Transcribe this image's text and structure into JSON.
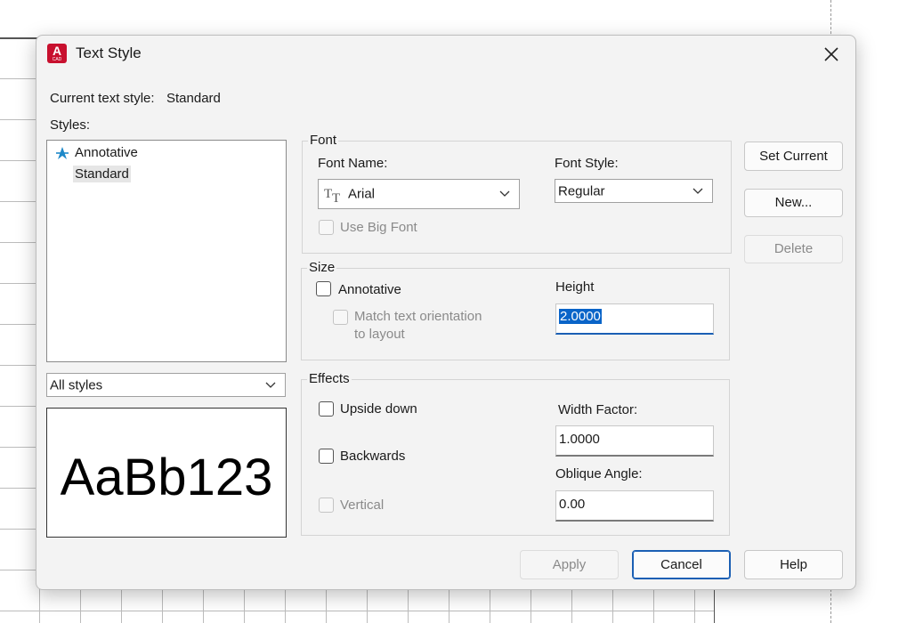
{
  "dialog": {
    "title": "Text Style",
    "app_icon": {
      "big": "A",
      "small": "CAD"
    }
  },
  "current_style": {
    "label": "Current text style:",
    "value": "Standard"
  },
  "styles": {
    "label": "Styles:",
    "items": [
      {
        "name": "Annotative",
        "icon": "annotative-icon"
      },
      {
        "name": "Standard",
        "selected": true
      }
    ],
    "filter": "All styles"
  },
  "preview": {
    "text": "AaBb123"
  },
  "font": {
    "group_label": "Font",
    "font_name_label": "Font Name:",
    "font_name_value": "Arial",
    "font_name_icon": "truetype-icon",
    "font_style_label": "Font Style:",
    "font_style_value": "Regular",
    "use_big_font": "Use Big Font"
  },
  "size": {
    "group_label": "Size",
    "annotative": "Annotative",
    "match_orientation_line1": "Match text orientation",
    "match_orientation_line2": "to layout",
    "height_label": "Height",
    "height_value": "2.0000"
  },
  "effects": {
    "group_label": "Effects",
    "upside_down": "Upside down",
    "backwards": "Backwards",
    "vertical": "Vertical",
    "width_factor_label": "Width Factor:",
    "width_factor_value": "1.0000",
    "oblique_label": "Oblique Angle:",
    "oblique_value": "0.00"
  },
  "buttons": {
    "set_current": "Set Current",
    "new": "New...",
    "delete": "Delete",
    "apply": "Apply",
    "cancel": "Cancel",
    "help": "Help"
  },
  "colors": {
    "accent": "#1a5fb4",
    "app_red": "#c8102e",
    "annotative_blue": "#1e88c8"
  }
}
